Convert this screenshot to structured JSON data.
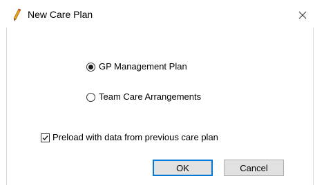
{
  "window": {
    "title": "New Care Plan",
    "app_icon": "pencil-icon",
    "close_icon": "close-icon"
  },
  "plan_type": {
    "options": [
      {
        "label": "GP Management Plan",
        "selected": true
      },
      {
        "label": "Team Care Arrangements",
        "selected": false
      }
    ]
  },
  "preload": {
    "label": "Preload with data from previous care plan",
    "checked": true
  },
  "buttons": {
    "ok_label": "OK",
    "cancel_label": "Cancel"
  },
  "colors": {
    "default_button_border": "#0078d7",
    "button_face": "#e1e1e1",
    "background": "#ffffff"
  }
}
